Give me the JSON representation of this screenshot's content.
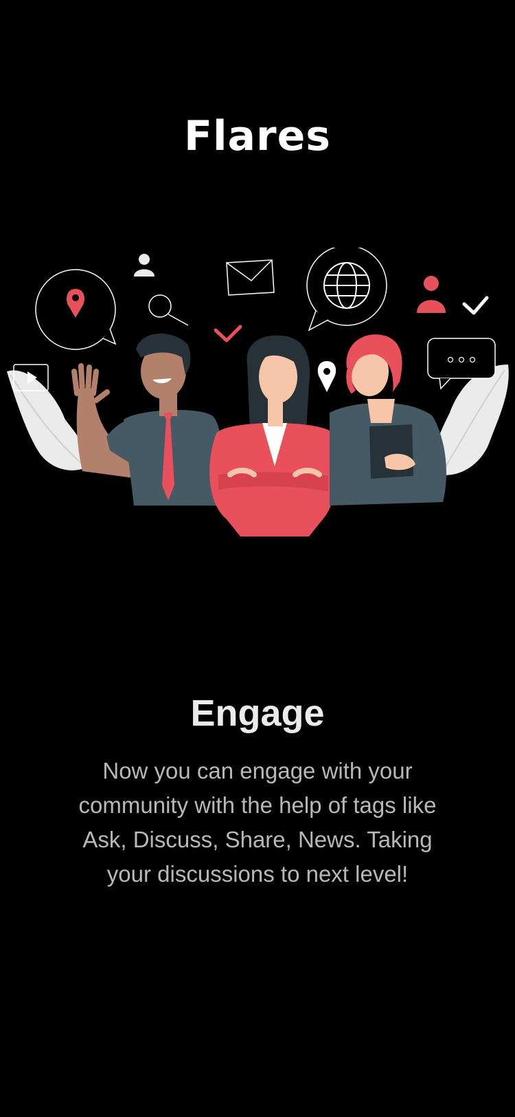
{
  "app": {
    "title": "Flares"
  },
  "onboarding": {
    "heading": "Engage",
    "body": "Now you can engage with your community with the help of tags like Ask, Discuss, Share, News. Taking your discussions to next level!"
  },
  "illustration": {
    "icons": [
      "location-pin-icon",
      "user-icon",
      "search-icon",
      "envelope-icon",
      "checkmark-icon",
      "globe-icon",
      "chat-bubble-icon",
      "play-icon"
    ],
    "colors": {
      "accent": "#e8505b",
      "shirt": "#455a64",
      "leaf": "#ebebeb",
      "outline": "#ffffff",
      "skin_dark": "#b2806b",
      "skin_light": "#f7c6a9",
      "hair": "#263238"
    }
  }
}
